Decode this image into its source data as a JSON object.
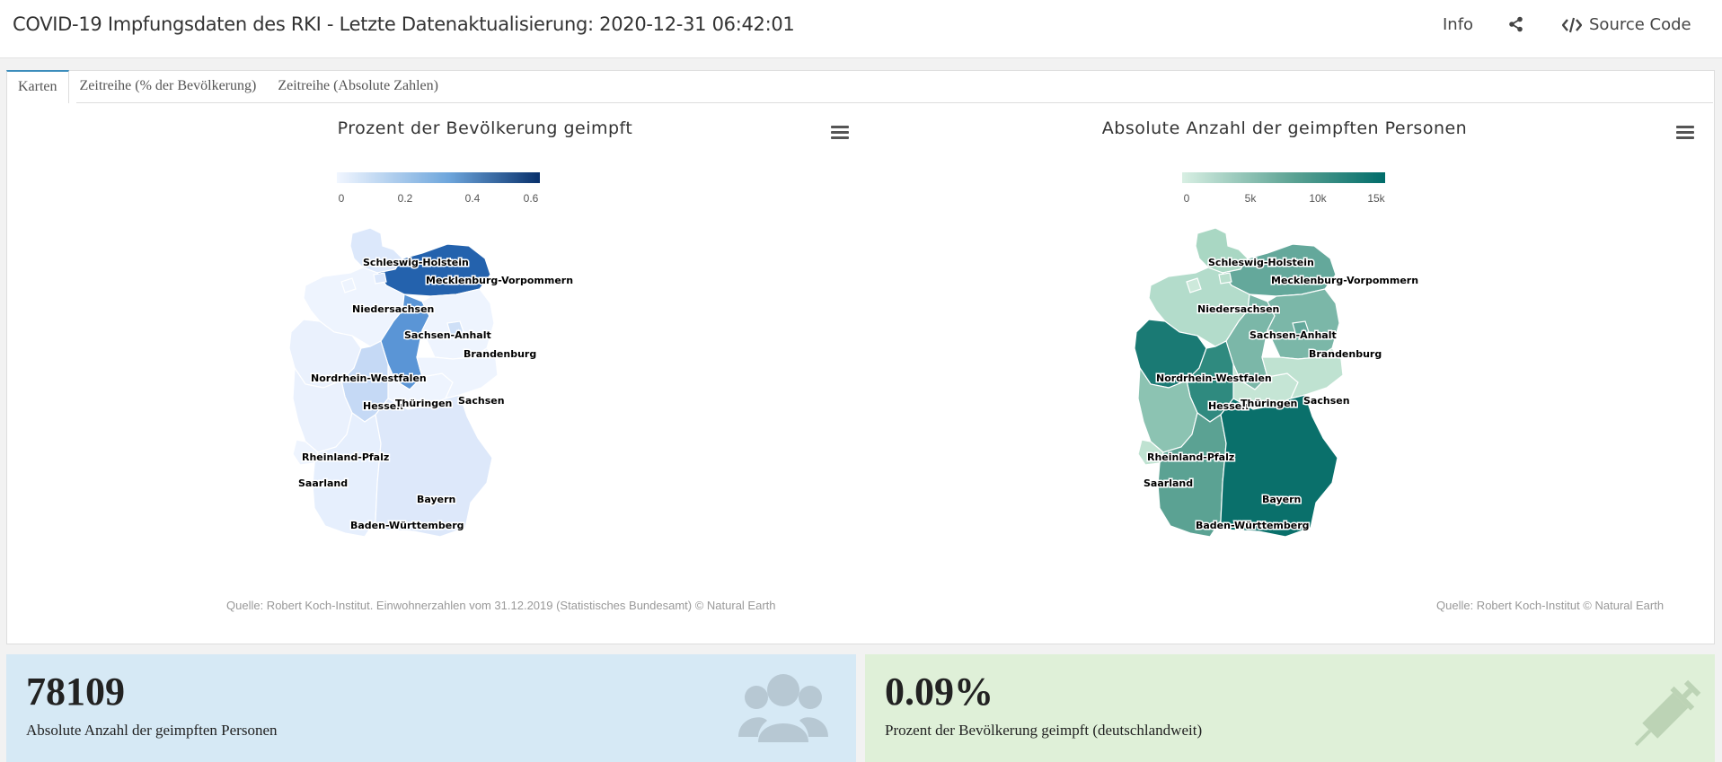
{
  "header": {
    "title": "COVID-19 Impfungsdaten des RKI - Letzte Datenaktualisierung: 2020-12-31 06:42:01",
    "info_label": "Info",
    "source_code_label": "Source Code"
  },
  "tabs": [
    {
      "label": "Karten",
      "active": true
    },
    {
      "label": "Zeitreihe (% der Bevölkerung)",
      "active": false
    },
    {
      "label": "Zeitreihe (Absolute Zahlen)",
      "active": false
    }
  ],
  "map_left": {
    "title": "Prozent der Bevölkerung geimpft",
    "legend_ticks": [
      "0",
      "0.2",
      "0.4",
      "0.6"
    ],
    "color_low": "#f1f6ff",
    "color_high": "#08306b",
    "source": "Quelle: Robert Koch-Institut. Einwohnerzahlen vom 31.12.2019 (Statistisches Bundesamt) © Natural Earth"
  },
  "map_right": {
    "title": "Absolute Anzahl der geimpften Personen",
    "legend_ticks": [
      "0",
      "5k",
      "10k",
      "15k"
    ],
    "color_low": "#d8efe3",
    "color_high": "#006c6a",
    "source": "Quelle: Robert Koch-Institut © Natural Earth"
  },
  "states": {
    "sh": "Schleswig-Holstein",
    "mv": "Mecklenburg-Vorpommern",
    "ni": "Niedersachsen",
    "st": "Sachsen-Anhalt",
    "bb": "Brandenburg",
    "nw": "Nordrhein-Westfalen",
    "sn": "Sachsen",
    "he": "Hessen",
    "th": "Thüringen",
    "rp": "Rheinland-Pfalz",
    "sl": "Saarland",
    "by": "Bayern",
    "bw": "Baden-Württemberg"
  },
  "colors_left": {
    "sh": "#dce8fb",
    "mv": "#2462ad",
    "ni": "#eef4fe",
    "st": "#5a95d6",
    "bb": "#eef4fe",
    "nw": "#eaf1fd",
    "sn": "#eef4fe",
    "he": "#c5d9f5",
    "th": "#eef4fe",
    "rp": "#eaf1fd",
    "sl": "#eef4fe",
    "by": "#dde8fa",
    "bw": "#e6effd",
    "hh": "#dbe7fb",
    "hb": "#eef4fe",
    "be": "#cfe0f7"
  },
  "colors_right": {
    "sh": "#a9d7c3",
    "mv": "#64a89b",
    "ni": "#b3dccb",
    "st": "#7bb7a8",
    "bb": "#7bb7a8",
    "nw": "#1a7a74",
    "sn": "#bfe2d1",
    "he": "#2f8a7f",
    "th": "#c5e5d5",
    "rp": "#8cc3b2",
    "sl": "#bfe2d1",
    "by": "#0a706b",
    "bw": "#5ba293",
    "hh": "#b9dfcd",
    "hb": "#cde9db",
    "be": "#64a89b"
  },
  "box_left": {
    "value": "78109",
    "label": "Absolute Anzahl der geimpften Personen",
    "bg": "#d6e9f5",
    "icon": "users-icon"
  },
  "box_right": {
    "value": "0.09%",
    "label": "Prozent der Bevölkerung geimpft (deutschlandweit)",
    "bg": "#dff0d8",
    "icon": "syringe-icon"
  }
}
